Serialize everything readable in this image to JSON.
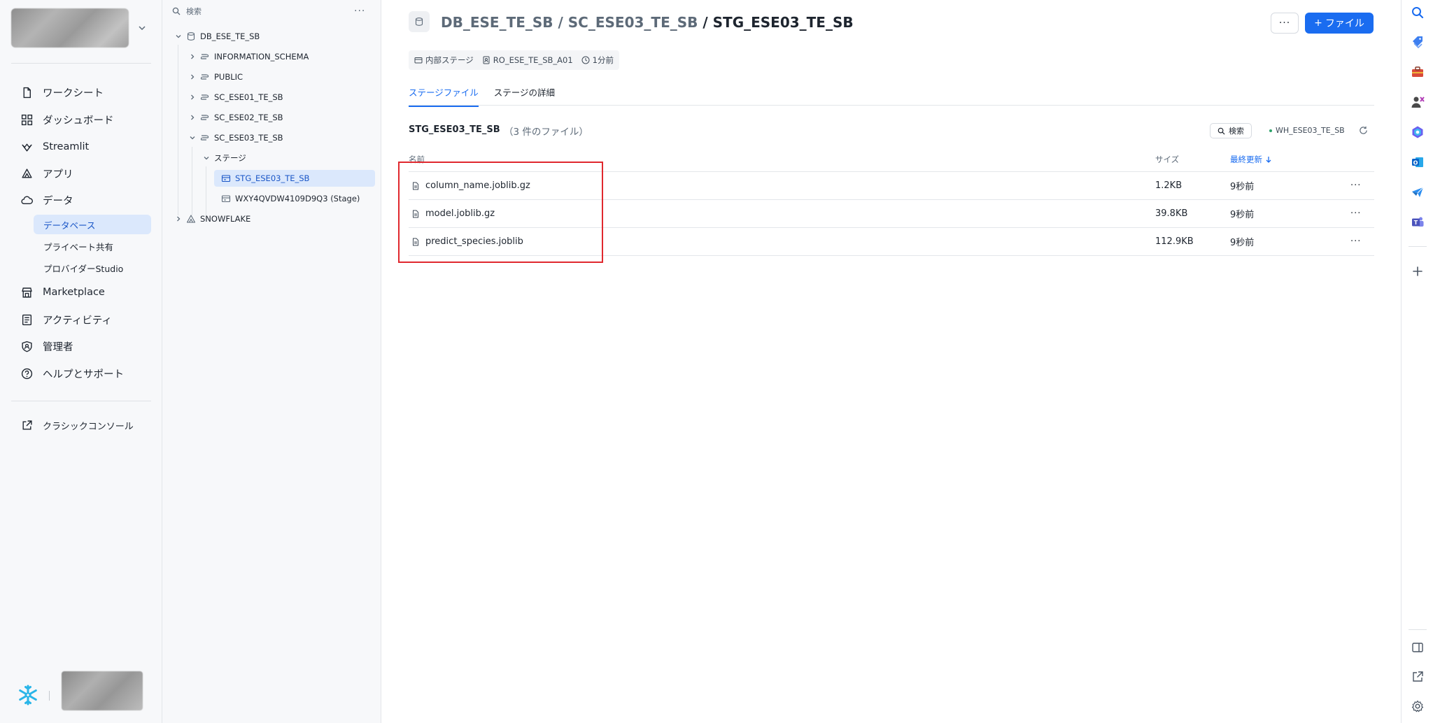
{
  "nav": {
    "items": [
      {
        "label": "ワークシート",
        "icon": "worksheet-icon"
      },
      {
        "label": "ダッシュボード",
        "icon": "dashboard-icon"
      },
      {
        "label": "Streamlit",
        "icon": "streamlit-icon"
      },
      {
        "label": "アプリ",
        "icon": "apps-icon"
      },
      {
        "label": "データ",
        "icon": "data-icon"
      }
    ],
    "data_sub": [
      "データベース",
      "プライベート共有",
      "プロバイダーStudio"
    ],
    "items2": [
      {
        "label": "Marketplace",
        "icon": "marketplace-icon"
      },
      {
        "label": "アクティビティ",
        "icon": "activity-icon"
      },
      {
        "label": "管理者",
        "icon": "admin-icon"
      },
      {
        "label": "ヘルプとサポート",
        "icon": "help-icon"
      }
    ],
    "classic_console": "クラシックコンソール"
  },
  "tree": {
    "search_placeholder": "検索",
    "database": "DB_ESE_TE_SB",
    "schemas": [
      "INFORMATION_SCHEMA",
      "PUBLIC",
      "SC_ESE01_TE_SB",
      "SC_ESE02_TE_SB",
      "SC_ESE03_TE_SB"
    ],
    "stages_folder": "ステージ",
    "stages": [
      "STG_ESE03_TE_SB",
      "WXY4QVDW4109D9Q3 (Stage)"
    ],
    "other_db": "SNOWFLAKE"
  },
  "main": {
    "breadcrumb_db": "DB_ESE_TE_SB",
    "breadcrumb_schema": "SC_ESE03_TE_SB",
    "breadcrumb_sep": "/",
    "breadcrumb_stage": "STG_ESE03_TE_SB",
    "more_label": "···",
    "file_button_plus": "+",
    "file_button_label": "ファイル",
    "meta": {
      "stage_type": "内部ステージ",
      "owner_role": "RO_ESE_TE_SB_A01",
      "updated": "1分前"
    },
    "tabs": [
      "ステージファイル",
      "ステージの詳細"
    ],
    "stage_name": "STG_ESE03_TE_SB",
    "file_count": "（3 件のファイル）",
    "search_label": "検索",
    "warehouse": "WH_ESE03_TE_SB",
    "columns": {
      "name": "名前",
      "size": "サイズ",
      "updated": "最終更新"
    },
    "files": [
      {
        "name": "column_name.joblib.gz",
        "size": "1.2KB",
        "updated": "9秒前"
      },
      {
        "name": "model.joblib.gz",
        "size": "39.8KB",
        "updated": "9秒前"
      },
      {
        "name": "predict_species.joblib",
        "size": "112.9KB",
        "updated": "9秒前"
      }
    ],
    "row_more": "···"
  },
  "colors": {
    "accent": "#1a6cf0",
    "highlight": "#e0282e",
    "snowflake_brand": "#29b5e8"
  }
}
